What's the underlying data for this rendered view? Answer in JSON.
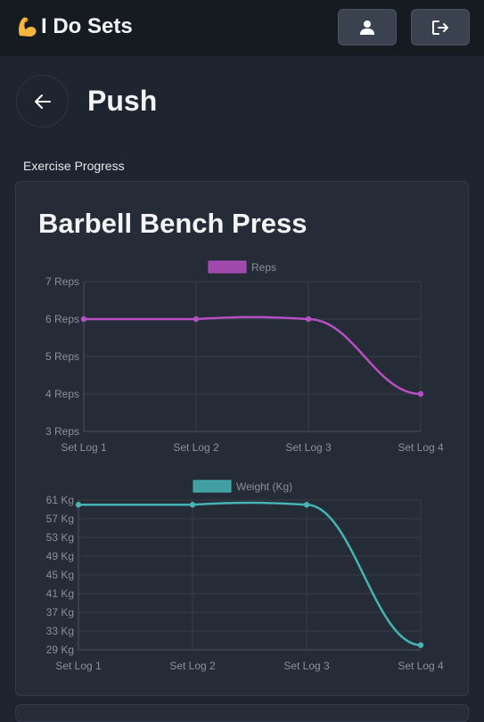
{
  "app": {
    "title": "I Do Sets",
    "logo_icon": "flexed-biceps-icon"
  },
  "header": {
    "profile_icon": "user-icon",
    "logout_icon": "logout-icon"
  },
  "page": {
    "title": "Push",
    "back_icon": "arrow-left-icon"
  },
  "section": {
    "label": "Exercise Progress"
  },
  "exercise": {
    "name": "Barbell Bench Press"
  },
  "colors": {
    "reps": "#b54fc2",
    "weight": "#46b4b4",
    "background": "#1f2530",
    "card": "#262c37"
  },
  "chart_data": [
    {
      "type": "line",
      "categories": [
        "Set Log 1",
        "Set Log 2",
        "Set Log 3",
        "Set Log 4"
      ],
      "series": [
        {
          "name": "Reps",
          "values": [
            6,
            6,
            6,
            4
          ],
          "color": "#b54fc2"
        }
      ],
      "yticks": [
        "3 Reps",
        "4 Reps",
        "5 Reps",
        "6 Reps",
        "7 Reps"
      ],
      "ylim": [
        3,
        7
      ],
      "legend": "top-center",
      "grid": true
    },
    {
      "type": "line",
      "categories": [
        "Set Log 1",
        "Set Log 2",
        "Set Log 3",
        "Set Log 4"
      ],
      "series": [
        {
          "name": "Weight (Kg)",
          "values": [
            60,
            60,
            60,
            30
          ],
          "color": "#46b4b4"
        }
      ],
      "yticks": [
        "29 Kg",
        "33 Kg",
        "37 Kg",
        "41 Kg",
        "45 Kg",
        "49 Kg",
        "53 Kg",
        "57 Kg",
        "61 Kg"
      ],
      "ylim": [
        29,
        61
      ],
      "legend": "top-center",
      "grid": true
    }
  ]
}
